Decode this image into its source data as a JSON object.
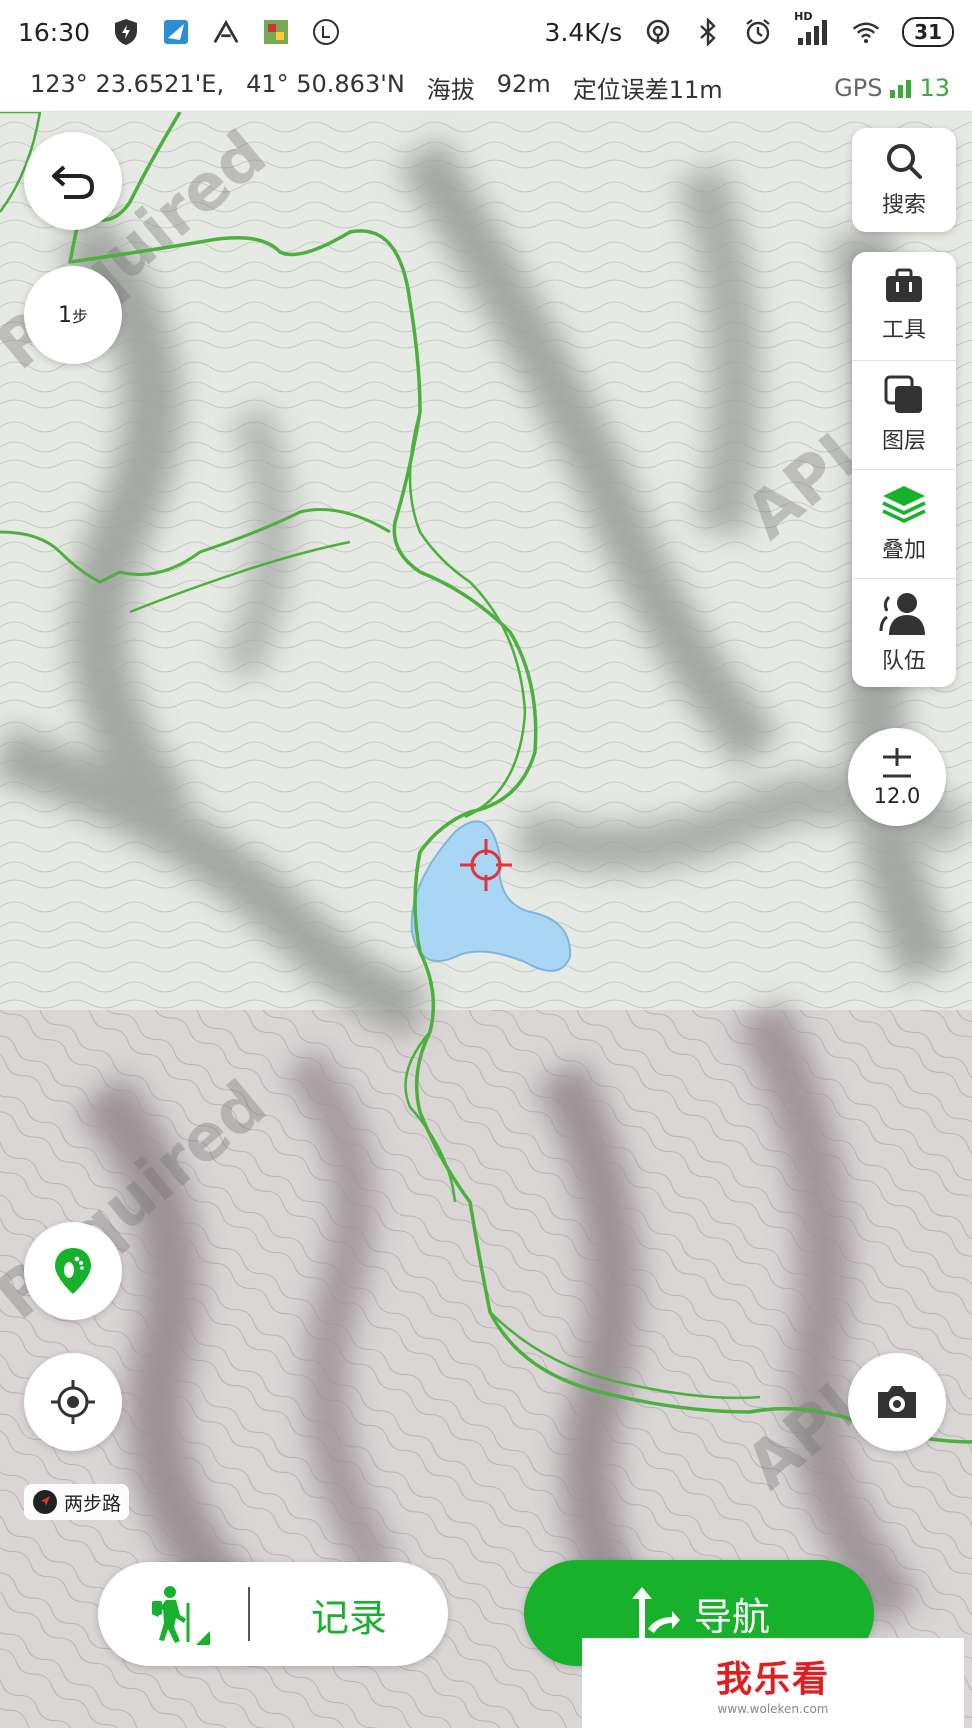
{
  "status_bar": {
    "time": "16:30",
    "network_speed": "3.4K/s",
    "battery": "31",
    "hd_label": "HD"
  },
  "coord_bar": {
    "longitude": "123°  23.6521'E,",
    "latitude": "41°  50.863'N",
    "altitude_label": "海拔",
    "altitude_value": "92m",
    "accuracy": "定位误差11m",
    "gps_label": "GPS",
    "gps_count": "13",
    "gps_color": "#3caa3c"
  },
  "map": {
    "watermarks": [
      "Required",
      "API",
      "Required",
      "API"
    ],
    "track_color": "#4caf3e",
    "lake_color": "#a9d6f5"
  },
  "left_controls": {
    "undo_icon": "undo-arrow-icon",
    "step_label": "1",
    "step_unit": "步",
    "footprint_icon": "footprint-icon",
    "locate_icon": "crosshair-icon",
    "brand_tag": "两步路"
  },
  "right_controls": {
    "search_label": "搜索",
    "tools": [
      {
        "label": "工具",
        "icon": "toolbox-icon"
      },
      {
        "label": "图层",
        "icon": "layers-icon"
      },
      {
        "label": "叠加",
        "icon": "overlay-icon"
      },
      {
        "label": "队伍",
        "icon": "team-icon"
      }
    ],
    "zoom_value": "12.0",
    "camera_icon": "camera-icon"
  },
  "bottom": {
    "record_label": "记录",
    "navigate_label": "导航",
    "accent": "#17b12c"
  },
  "overlay_watermark": {
    "text": "我乐看",
    "url": "www.woleken.com"
  }
}
